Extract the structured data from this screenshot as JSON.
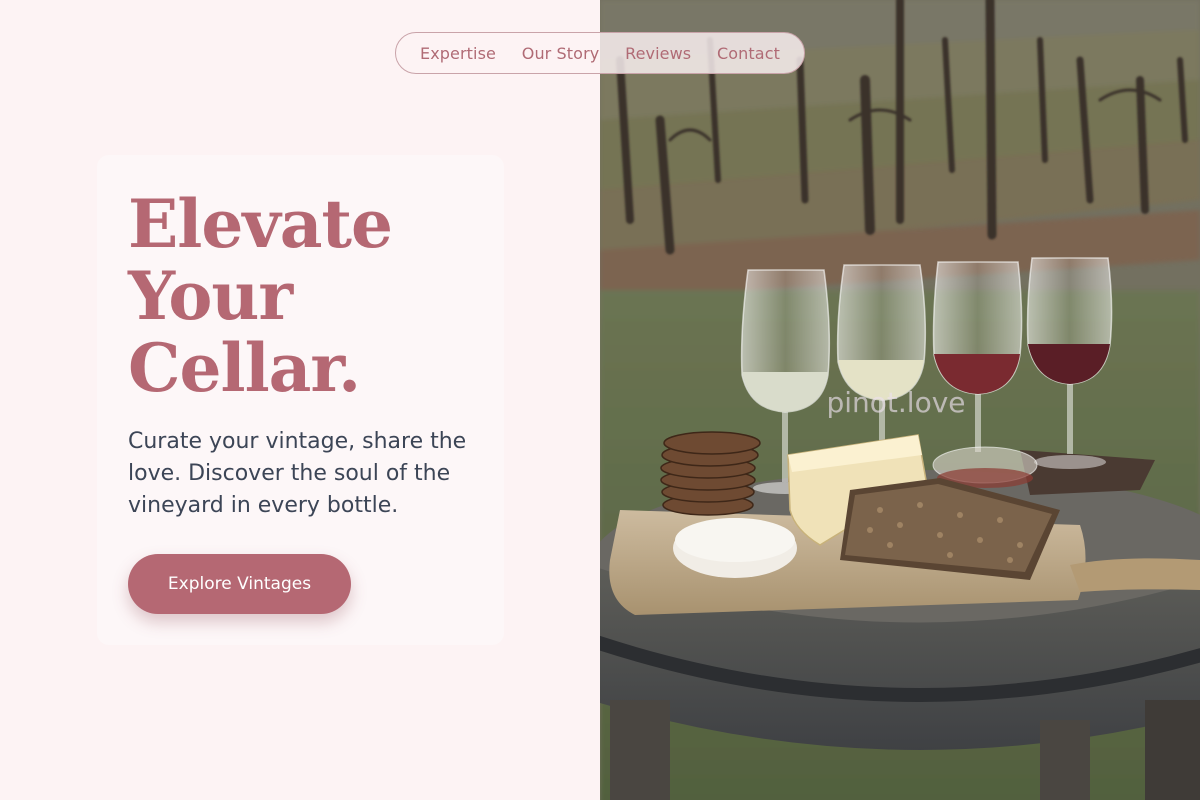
{
  "nav": {
    "items": [
      {
        "label": "Expertise"
      },
      {
        "label": "Our Story"
      },
      {
        "label": "Reviews"
      },
      {
        "label": "Contact"
      }
    ]
  },
  "hero": {
    "headline_lines": [
      "Elevate",
      "Your",
      "Cellar."
    ],
    "subtitle": "Curate your vintage, share the love. Discover the soul of the vineyard in every bottle.",
    "cta_label": "Explore Vintages"
  },
  "photo": {
    "watermark": "pinot.love",
    "subject": "wine glasses with cheese and crackers on a wooden barrel table in a vineyard"
  },
  "colors": {
    "background": "#fdf3f4",
    "card": "#fdf7f8",
    "accent": "#b56873",
    "nav_text": "#b06b75",
    "body_text": "#3c4556"
  }
}
